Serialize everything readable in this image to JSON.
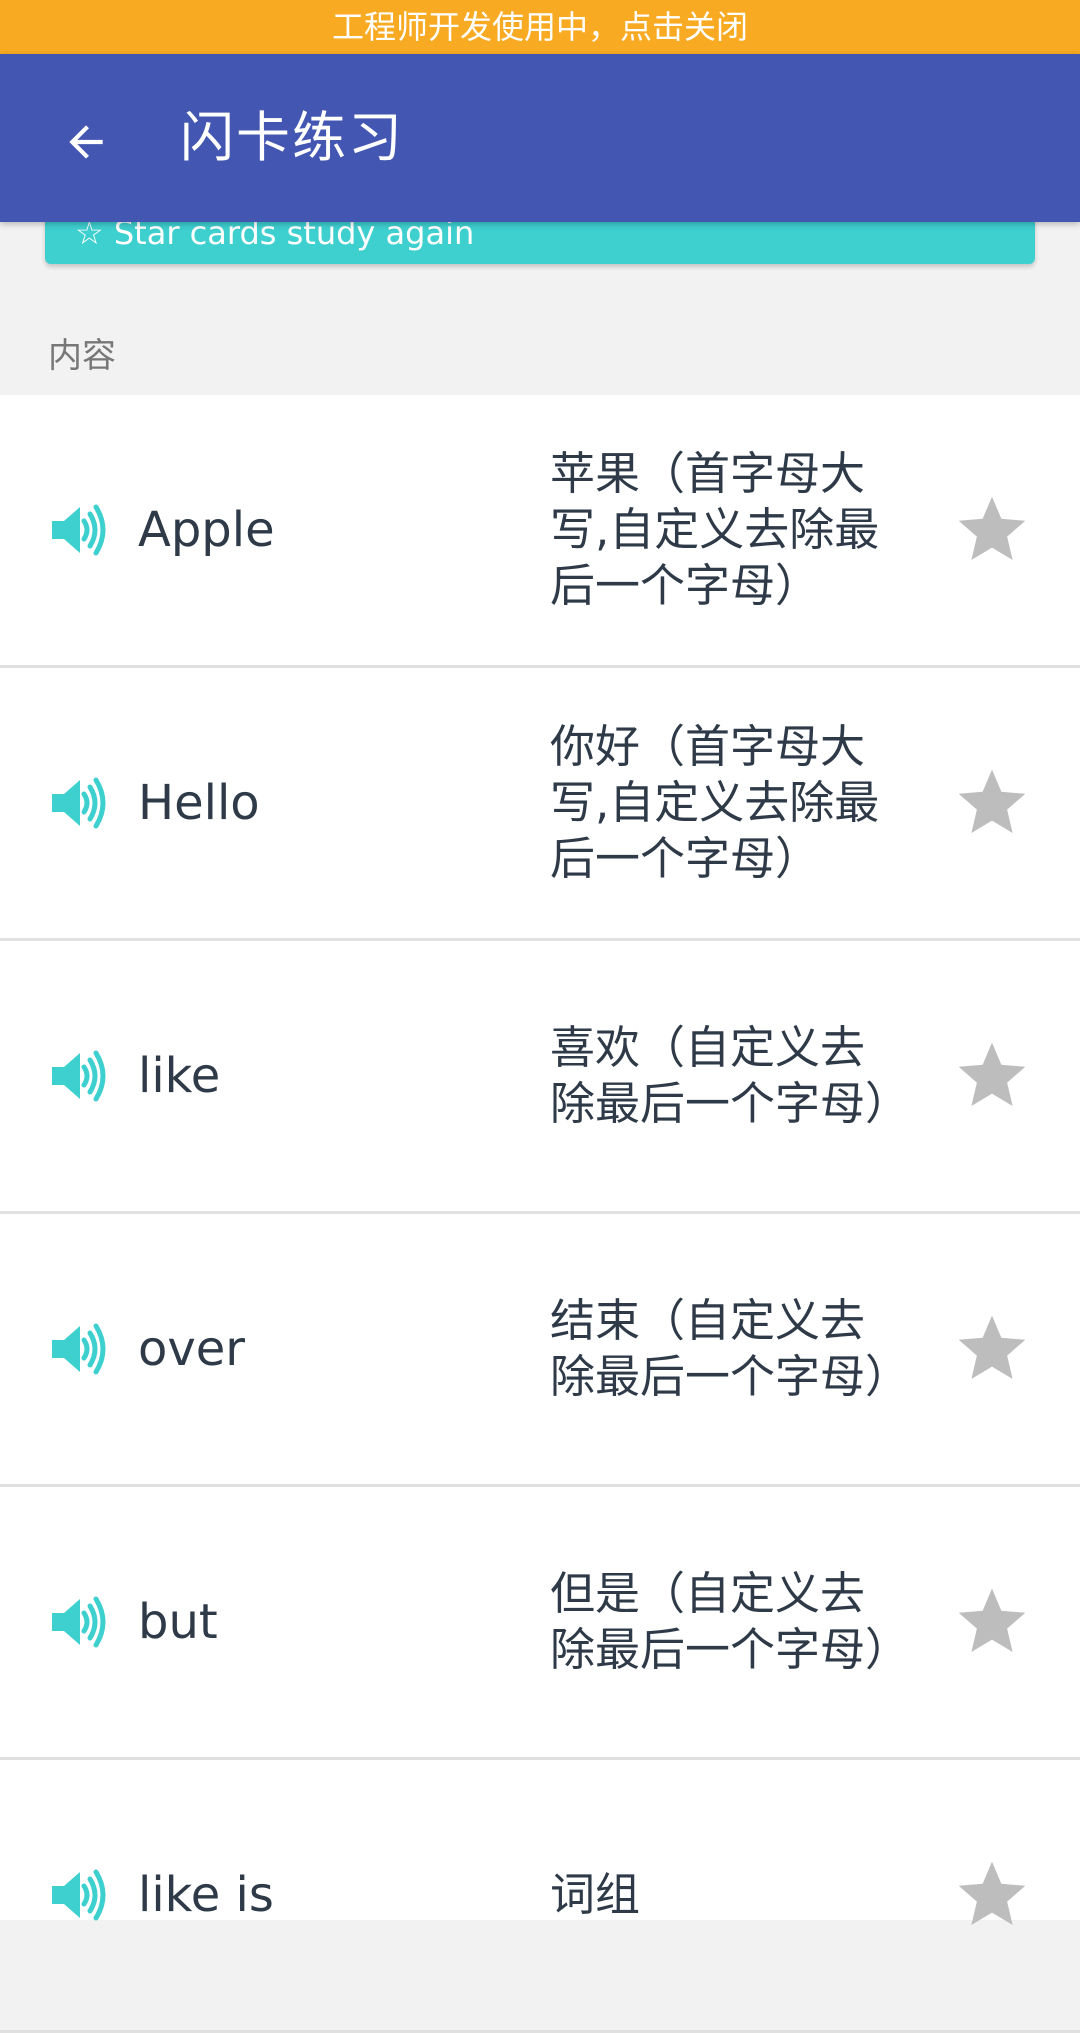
{
  "dev_banner": {
    "text": "工程师开发使用中，点击关闭"
  },
  "appbar": {
    "title": "闪卡练习",
    "back_icon": "arrow-left-icon"
  },
  "teal_card": {
    "text": "☆ Star cards study again"
  },
  "section": {
    "label": "内容"
  },
  "colors": {
    "banner": "#f8aa22",
    "appbar": "#4356b2",
    "accent": "#3ecfcf",
    "star_inactive": "#bdbdbd",
    "text": "#2e3a48"
  },
  "items": [
    {
      "word": "Apple",
      "meaning": "苹果（首字母大写,自定义去除最后一个字母）",
      "speaker_icon": "speaker-icon",
      "star_icon": "star-icon",
      "starred": false
    },
    {
      "word": "Hello",
      "meaning": "你好（首字母大写,自定义去除最后一个字母）",
      "speaker_icon": "speaker-icon",
      "star_icon": "star-icon",
      "starred": false
    },
    {
      "word": "like",
      "meaning": "喜欢（自定义去除最后一个字母）",
      "speaker_icon": "speaker-icon",
      "star_icon": "star-icon",
      "starred": false
    },
    {
      "word": "over",
      "meaning": "结束（自定义去除最后一个字母）",
      "speaker_icon": "speaker-icon",
      "star_icon": "star-icon",
      "starred": false
    },
    {
      "word": "but",
      "meaning": "但是（自定义去除最后一个字母）",
      "speaker_icon": "speaker-icon",
      "star_icon": "star-icon",
      "starred": false
    },
    {
      "word": "like is",
      "meaning": "词组",
      "speaker_icon": "speaker-icon",
      "star_icon": "star-icon",
      "starred": false
    }
  ]
}
